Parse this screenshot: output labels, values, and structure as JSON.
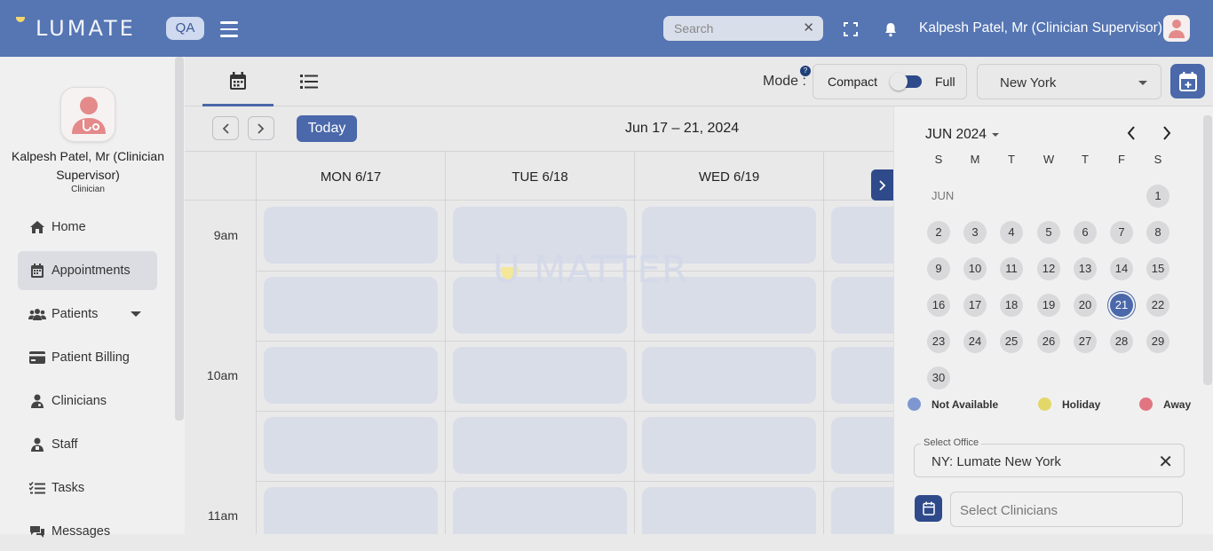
{
  "header": {
    "logo": "LUMATE",
    "env_badge": "QA",
    "search_placeholder": "Search",
    "user_name": "Kalpesh Patel, Mr (Clinician Supervisor)"
  },
  "sidebar": {
    "profile_name": "Kalpesh Patel, Mr (Clinician Supervisor)",
    "profile_role": "Clinician",
    "items": [
      {
        "label": "Home",
        "icon": "home-icon"
      },
      {
        "label": "Appointments",
        "icon": "calendar-icon"
      },
      {
        "label": "Patients",
        "icon": "users-icon"
      },
      {
        "label": "Patient Billing",
        "icon": "credit-card-icon"
      },
      {
        "label": "Clinicians",
        "icon": "doctor-icon"
      },
      {
        "label": "Staff",
        "icon": "staff-icon"
      },
      {
        "label": "Tasks",
        "icon": "tasks-icon"
      },
      {
        "label": "Messages",
        "icon": "messages-icon"
      }
    ]
  },
  "toolbar": {
    "mode_label": "Mode :",
    "mode_help": "?",
    "mode_compact": "Compact",
    "mode_full": "Full",
    "city": "New York"
  },
  "calendar": {
    "today_label": "Today",
    "range": "Jun 17 – 21, 2024",
    "days": [
      "MON 6/17",
      "TUE 6/18",
      "WED 6/19"
    ],
    "times": [
      "9am",
      "10am",
      "11am"
    ],
    "watermark": "U MATTER"
  },
  "mini_calendar": {
    "month_label": "JUN 2024",
    "month_short": "JUN",
    "weekdays": [
      "S",
      "M",
      "T",
      "W",
      "T",
      "F",
      "S"
    ],
    "days": [
      1,
      2,
      3,
      4,
      5,
      6,
      7,
      8,
      9,
      10,
      11,
      12,
      13,
      14,
      15,
      16,
      17,
      18,
      19,
      20,
      21,
      22,
      23,
      24,
      25,
      26,
      27,
      28,
      29,
      30
    ],
    "selected": 21
  },
  "legend": [
    {
      "label": "Not Available",
      "color": "#7f97d1"
    },
    {
      "label": "Holiday",
      "color": "#e3d76a"
    },
    {
      "label": "Away",
      "color": "#e27582"
    }
  ],
  "filters": {
    "office_label": "Select Office",
    "office_value": "NY: Lumate New York",
    "clinicians_placeholder": "Select Clinicians"
  },
  "colors": {
    "brand": "#5575b3",
    "accent": "#4a68aa",
    "dark_accent": "#2e4a8a"
  }
}
